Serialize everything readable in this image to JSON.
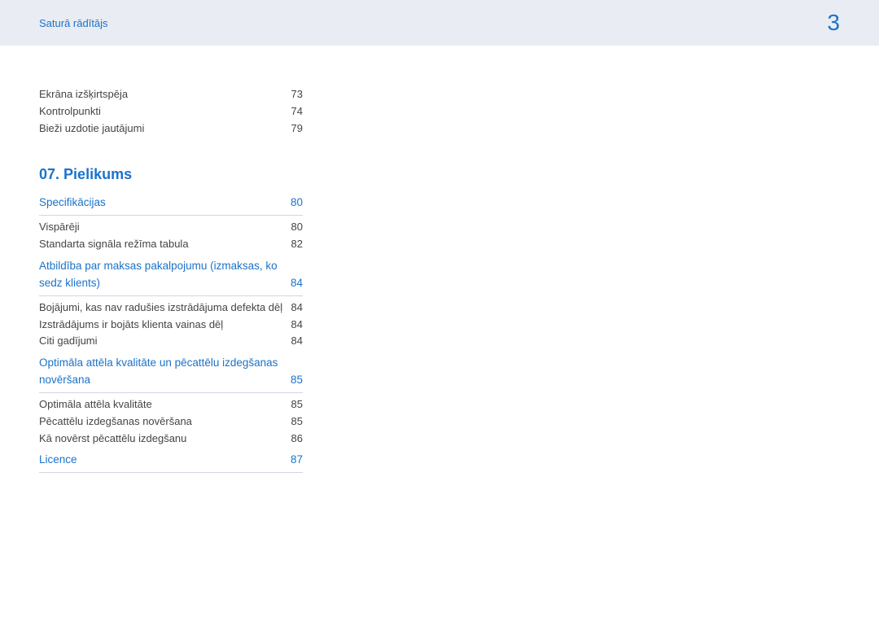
{
  "header": {
    "link": "Saturā rādītājs",
    "page_number": "3"
  },
  "pre_entries": [
    {
      "label": "Ekrāna izšķirtspēja",
      "page": "73"
    },
    {
      "label": "Kontrolpunkti",
      "page": "74"
    },
    {
      "label": "Bieži uzdotie jautājumi",
      "page": "79"
    }
  ],
  "chapter": {
    "number": "07.",
    "title": "Pielikums"
  },
  "sections": [
    {
      "title": "Specifikācijas",
      "page": "80",
      "items": [
        {
          "label": "Vispārēji",
          "page": "80"
        },
        {
          "label": "Standarta signāla režīma tabula",
          "page": "82"
        }
      ]
    },
    {
      "title": "Atbildība par maksas pakalpojumu (izmaksas, ko sedz klients)",
      "page": "84",
      "items": [
        {
          "label": "Bojājumi, kas nav radušies izstrādājuma defekta dēļ",
          "page": "84"
        },
        {
          "label": "Izstrādājums ir bojāts klienta vainas dēļ",
          "page": "84"
        },
        {
          "label": "Citi gadījumi",
          "page": "84"
        }
      ]
    },
    {
      "title": "Optimāla attēla kvalitāte un pēcattēlu izdegšanas novēršana",
      "page": "85",
      "items": [
        {
          "label": "Optimāla attēla kvalitāte",
          "page": "85"
        },
        {
          "label": "Pēcattēlu izdegšanas novēršana",
          "page": "85"
        },
        {
          "label": "Kā novērst pēcattēlu izdegšanu",
          "page": "86"
        }
      ]
    },
    {
      "title": "Licence",
      "page": "87",
      "items": []
    }
  ]
}
